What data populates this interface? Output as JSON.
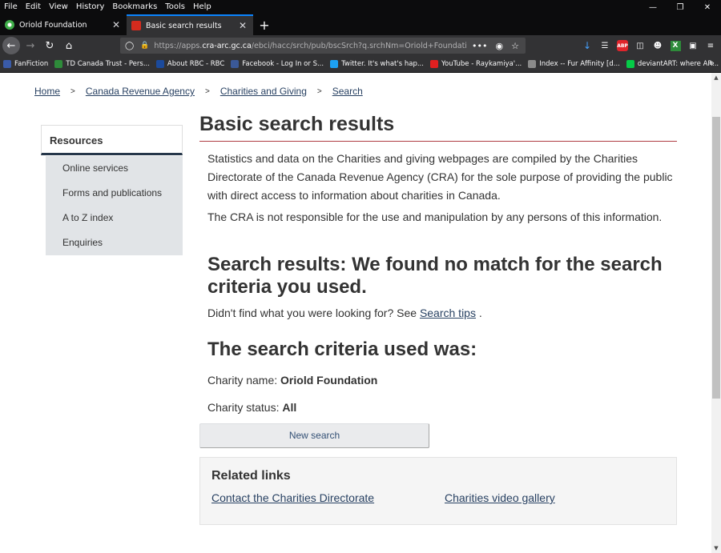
{
  "browser": {
    "menu": [
      "File",
      "Edit",
      "View",
      "History",
      "Bookmarks",
      "Tools",
      "Help"
    ],
    "tabs": [
      {
        "title": "Oriold Foundation",
        "close": "✕"
      },
      {
        "title": "Basic search results",
        "close": "✕"
      }
    ],
    "new_tab": "+",
    "url": {
      "prefix": "https://apps.",
      "domain": "cra-arc.gc.ca",
      "rest": "/ebci/hacc/srch/pub/bscSrch?q.srchNm=Oriold+Foundation&q.stts=",
      "more_icon": "•••"
    },
    "bookmarks": [
      {
        "label": "FanFiction",
        "color": "#3a5ba8"
      },
      {
        "label": "TD Canada Trust - Pers...",
        "color": "#2e8b3a"
      },
      {
        "label": "About RBC - RBC",
        "color": "#1b4a9c"
      },
      {
        "label": "Facebook - Log In or S...",
        "color": "#3b5998"
      },
      {
        "label": "Twitter. It's what's hap...",
        "color": "#1da1f2"
      },
      {
        "label": "YouTube - Raykamiya'...",
        "color": "#e02020"
      },
      {
        "label": "Index -- Fur Affinity [d...",
        "color": "#8a8a8a"
      },
      {
        "label": "deviantART: where AR...",
        "color": "#05cc47"
      }
    ],
    "colors": {
      "accent": "#0a84ff",
      "chrome_dark": "#0c0c0d",
      "chrome_mid": "#323234"
    }
  },
  "breadcrumb": {
    "items": [
      "Home",
      "Canada Revenue Agency",
      "Charities and Giving",
      "Search"
    ],
    "separator": ">"
  },
  "sidenav": {
    "heading": "Resources",
    "items": [
      "Online services",
      "Forms and publications",
      "A to Z index",
      "Enquiries"
    ]
  },
  "main": {
    "title": "Basic search results",
    "intro": "Statistics and data on the Charities and giving webpages are compiled by the Charities Directorate of the Canada Revenue Agency (CRA) for the sole purpose of providing the public with direct access to information about charities in Canada.",
    "disclaimer": "The CRA is not responsible for the use and manipulation by any persons of this information.",
    "results_heading": "Search results: We found no match for the search criteria you used.",
    "tip_prefix": "Didn't find what you were looking for? See",
    "tip_link": "Search tips",
    "tip_suffix": ".",
    "criteria_heading": "The search criteria used was:",
    "criteria": {
      "name_label": "Charity name:",
      "name_value": "Oriold Foundation",
      "status_label": "Charity status:",
      "status_value": "All"
    },
    "new_search_button": "New search",
    "related": {
      "title": "Related links",
      "links": [
        "Contact the Charities Directorate",
        "Charities video gallery"
      ]
    }
  }
}
